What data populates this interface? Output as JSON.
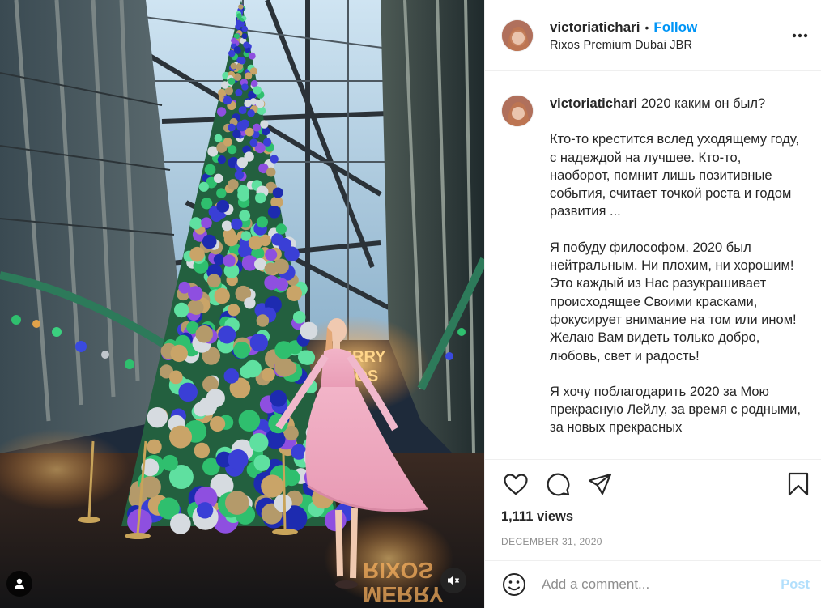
{
  "post": {
    "username": "victoriatichari",
    "follow_label": "Follow",
    "separator": "•",
    "location": "Rixos Premium Dubai JBR",
    "more_icon": "more-horizontal-icon"
  },
  "caption": {
    "username": "victoriatichari",
    "first_line": "2020 каким он был?",
    "paragraphs": [
      "Кто-то крестится вслед уходящему году, с надеждой на лучшее. Кто-то, наоборот, помнит лишь позитивные события, считает точкой роста и годом развития ...",
      "Я побуду философом. 2020 был нейтральным. Ни плохим, ни хорошим! Это каждый из Нас разукрашивает происходящее Своими красками, фокусирует внимание на том или ином! Желаю Вам видеть только добро, любовь, свет и радость!",
      "Я хочу поблагодарить 2020 за Мою прекрасную Лейлу, за время с родными, за новых прекрасных"
    ]
  },
  "stats": {
    "views": "1,111 views",
    "date": "DECEMBER 31, 2020"
  },
  "comment_box": {
    "placeholder": "Add a comment...",
    "post_label": "Post"
  },
  "media": {
    "sign_text_1": "MERRY",
    "sign_text_2": "RIXOS",
    "reflection_1": "RIXOS",
    "reflection_2": "MERRY"
  },
  "colors": {
    "accent": "#0095f6",
    "post_disabled": "#b2dffc",
    "secondary_text": "#8e8e8e"
  }
}
